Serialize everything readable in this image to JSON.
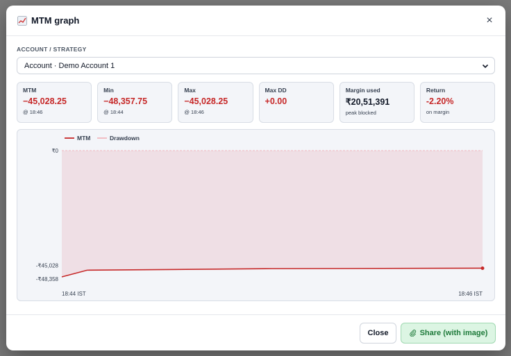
{
  "modal": {
    "title": "MTM graph",
    "title_icon": "chart-icon",
    "close_icon": "close-icon",
    "close_glyph": "×"
  },
  "selector": {
    "label": "ACCOUNT / STRATEGY",
    "value": "Account · Demo Account 1"
  },
  "stats": [
    {
      "label": "MTM",
      "value": "−45,028.25",
      "sub": "@ 18:46",
      "tone": "negative"
    },
    {
      "label": "Min",
      "value": "−48,357.75",
      "sub": "@ 18:44",
      "tone": "negative"
    },
    {
      "label": "Max",
      "value": "−45,028.25",
      "sub": "@ 18:46",
      "tone": "negative"
    },
    {
      "label": "Max DD",
      "value": "+0.00",
      "sub": "",
      "tone": "negative"
    },
    {
      "label": "Margin used",
      "value": "₹20,51,391",
      "sub": "peak blocked",
      "tone": "neutral"
    },
    {
      "label": "Return",
      "value": "-2.20%",
      "sub": "on margin",
      "tone": "negative"
    }
  ],
  "chart_data": {
    "type": "line",
    "legend": [
      "MTM",
      "Drawdown"
    ],
    "legend_position": "top-left",
    "y_tick_labels": [
      "₹0",
      "-₹45,028",
      "-₹48,358"
    ],
    "y_ticks": [
      0,
      -45028,
      -48358
    ],
    "x_tick_labels": [
      "18:44 IST",
      "18:46 IST"
    ],
    "series": [
      {
        "name": "MTM",
        "color": "#c62828",
        "points": [
          [
            0,
            -48358
          ],
          [
            0.06,
            -45800
          ],
          [
            0.5,
            -45200
          ],
          [
            1,
            -45028
          ]
        ]
      },
      {
        "name": "Drawdown",
        "color": "#f2b8bf",
        "fill": "#efdfe5",
        "baseline": 0
      }
    ],
    "ylim": [
      -48358,
      0
    ]
  },
  "footer": {
    "close_label": "Close",
    "share_label": "Share (with image)",
    "share_icon": "paperclip-icon"
  },
  "colors": {
    "negative": "#c62828",
    "share_bg": "#dcf5e3",
    "share_text": "#1e7a3a"
  }
}
